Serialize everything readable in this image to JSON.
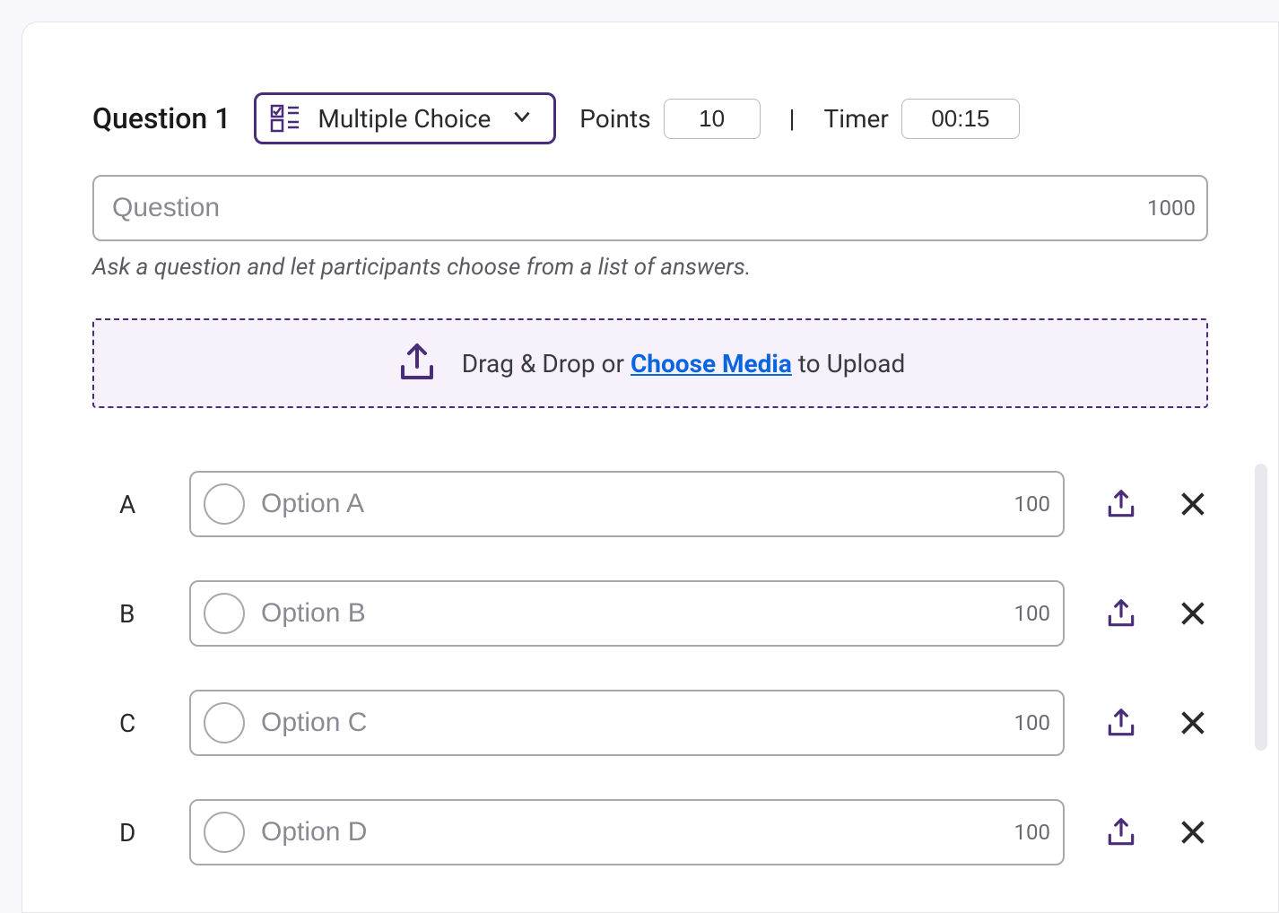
{
  "header": {
    "title": "Question 1",
    "type_label": "Multiple Choice",
    "points_label": "Points",
    "points_value": "10",
    "divider": "|",
    "timer_label": "Timer",
    "timer_value": "00:15"
  },
  "question": {
    "placeholder": "Question",
    "char_limit": "1000",
    "hint": "Ask a question and let participants choose from a list of answers."
  },
  "upload": {
    "prefix": "Drag & Drop or ",
    "link": "Choose Media",
    "suffix": " to Upload"
  },
  "options": [
    {
      "letter": "A",
      "placeholder": "Option A",
      "char_limit": "100"
    },
    {
      "letter": "B",
      "placeholder": "Option B",
      "char_limit": "100"
    },
    {
      "letter": "C",
      "placeholder": "Option C",
      "char_limit": "100"
    },
    {
      "letter": "D",
      "placeholder": "Option D",
      "char_limit": "100"
    }
  ]
}
